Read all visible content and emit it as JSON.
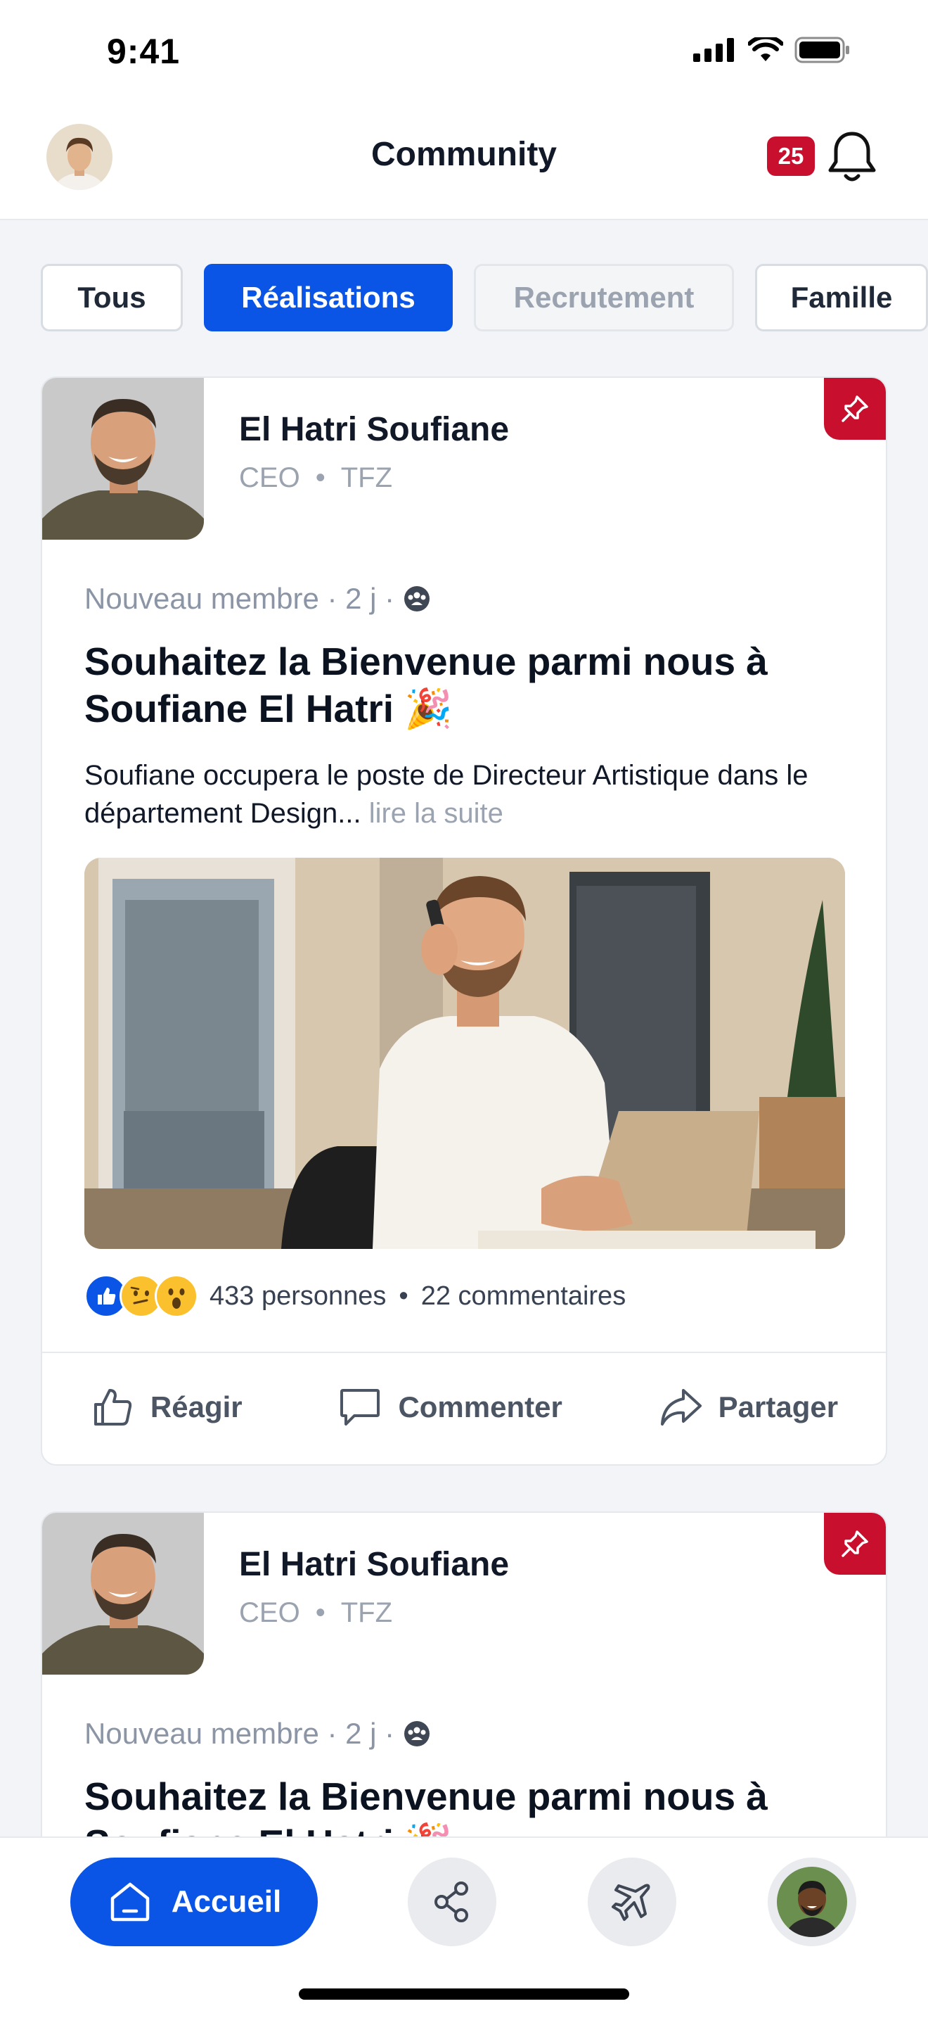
{
  "status_bar": {
    "time": "9:41"
  },
  "header": {
    "title": "Community",
    "notification_count": "25"
  },
  "filters": [
    {
      "label": "Tous",
      "state": "default"
    },
    {
      "label": "Réalisations",
      "state": "active"
    },
    {
      "label": "Recrutement",
      "state": "disabled"
    },
    {
      "label": "Famille",
      "state": "default"
    }
  ],
  "posts": [
    {
      "author": "El Hatri Soufiane",
      "role": "CEO",
      "company": "TFZ",
      "meta": "Nouveau membre · 2 j ·",
      "headline": "Souhaitez la Bienvenue parmi nous à Soufiane El Hatri 🎉",
      "excerpt": "Soufiane occupera le poste de Directeur Artistique dans le département Design...",
      "read_more": "lire la suite",
      "reactions_count": "433 personnes",
      "comments_count": "22 commentaires",
      "actions": {
        "react": "Réagir",
        "comment": "Commenter",
        "share": "Partager"
      }
    },
    {
      "author": "El Hatri Soufiane",
      "role": "CEO",
      "company": "TFZ",
      "meta": "Nouveau membre · 2 j ·",
      "headline": "Souhaitez la Bienvenue parmi nous à Soufiane El Hatri 🎉"
    }
  ],
  "bottom_nav": {
    "home_label": "Accueil"
  },
  "colors": {
    "primary": "#0A55E6",
    "accent": "#C8102E",
    "muted": "#9AA3AF"
  }
}
